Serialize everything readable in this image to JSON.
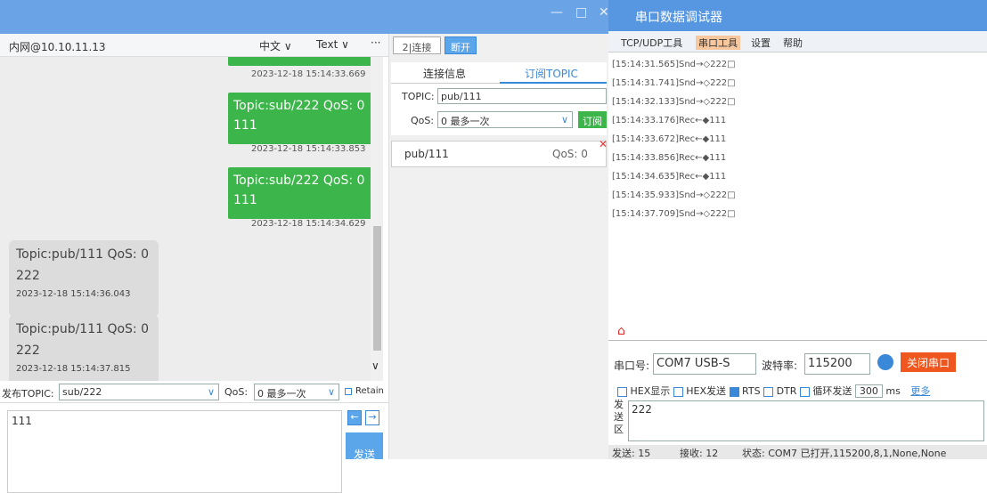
{
  "left": {
    "host": "内网@10.10.11.13",
    "lang": "中文 ∨",
    "format": "Text ∨",
    "more": "···",
    "messages": [
      {
        "kind": "sent",
        "lines": [
          "Topic:sub/222  QoS: 0",
          "111"
        ],
        "time": "2023-12-18 15:14:33.853"
      },
      {
        "kind": "sent",
        "lines": [
          "Topic:sub/222  QoS: 0",
          "111"
        ],
        "time": "2023-12-18 15:14:34.629"
      },
      {
        "kind": "recv",
        "lines": [
          "Topic:pub/111  QoS: 0",
          "222"
        ],
        "time": "2023-12-18 15:14:36.043"
      },
      {
        "kind": "recv",
        "lines": [
          "Topic:pub/111  QoS: 0",
          "222"
        ],
        "time": "2023-12-18 15:14:37.815"
      }
    ],
    "top_time": "2023-12-18 15:14:33.669",
    "publish_label": "发布TOPIC:",
    "publish_topic": "sub/222",
    "qos_label": "QoS:",
    "qos_value": "0 最多一次",
    "retain": "Retain",
    "message": "111",
    "send": "发送"
  },
  "mid": {
    "connect_btn": "2|连接",
    "disconnect_btn": "断开",
    "tab_info": "连接信息",
    "tab_sub": "订阅TOPIC",
    "topic_label": "TOPIC:",
    "topic_value": "pub/111",
    "qos_label": "QoS:",
    "qos_value": "0 最多一次",
    "subscribe": "订阅",
    "sub_topic": "pub/111",
    "sub_qos": "QoS: 0"
  },
  "right": {
    "title": "串口数据调试器",
    "menu": [
      "TCP/UDP工具",
      "串口工具",
      "设置",
      "帮助"
    ],
    "log": [
      "[15:14:31.565]Snd→◇222□",
      "[15:14:31.741]Snd→◇222□",
      "[15:14:32.133]Snd→◇222□",
      "[15:14:33.176]Rec←◆111",
      "[15:14:33.672]Rec←◆111",
      "[15:14:33.856]Rec←◆111",
      "[15:14:34.635]Rec←◆111",
      "[15:14:35.933]Snd→◇222□",
      "[15:14:37.709]Snd→◇222□"
    ],
    "port_label": "串口号:",
    "port_value": "COM7 USB-S",
    "baud_label": "波特率:",
    "baud_value": "115200",
    "close_port": "关闭串口",
    "hex_display": "HEX显示",
    "hex_send": "HEX发送",
    "rts": "RTS",
    "dtr": "DTR",
    "loop_send": "循环发送",
    "interval": "300",
    "ms": "ms",
    "more": "更多",
    "send_area_label": "发送区",
    "send_content": "222",
    "status_sent": "发送: 15",
    "status_recv": "接收: 12",
    "status_text": "状态:  COM7 已打开,115200,8,1,None,None"
  },
  "colors": {
    "green": "#3cb54a",
    "blue": "#5797e2",
    "orange": "#f0571e"
  }
}
